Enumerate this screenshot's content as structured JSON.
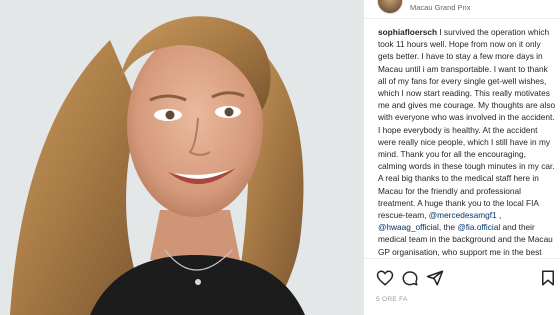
{
  "post": {
    "location": "Macau Grand Prix",
    "username": "sophiafloersch",
    "caption_part1": " I survived the operation which took 11 hours well. Hope from now on it only gets better. I have to stay a few more days in Macau until i am transportable. I want to thank all of my fans for every single get-well wishes, which I now start reading. This really motivates me and gives me courage. My thoughts are also with everyone who was involved in the accident. I hope everybody is healthy. At the accident were really nice people, which I still have in my mind. Thank you for all the encouraging, calming words in these tough minutes in my car. A real big thanks to the medical staff here in Macau for the friendly and professional treatment. A huge thank you to the local FIA rescue-team,",
    "mention1": "@mercedesamgf1",
    "sep1": " , ",
    "mention2": "@hwaag_official",
    "sep2": ", the",
    "mention3": "@fia.official",
    "caption_part2": " and their medical team in the background and the Macau GP organisation, who support me in the best possible way with the best care. Thank you",
    "timestamp": "5 ORE FA"
  },
  "icons": {
    "like": "heart-icon",
    "comment": "comment-icon",
    "share": "share-icon",
    "save": "bookmark-icon"
  },
  "colors": {
    "mention": "#003569",
    "text": "#262626"
  }
}
